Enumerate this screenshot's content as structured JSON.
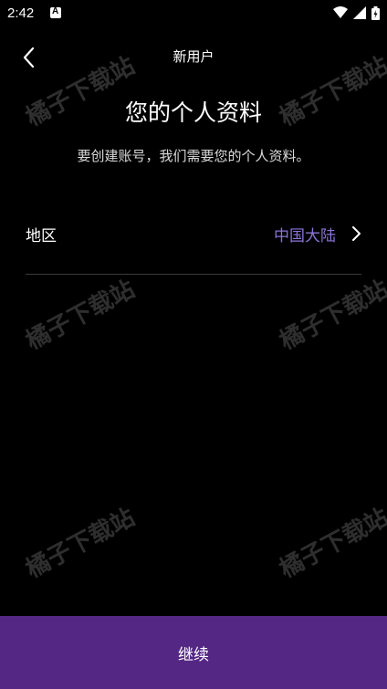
{
  "status_bar": {
    "time": "2:42",
    "icons": [
      "a-notification-icon",
      "wifi-icon",
      "signal-icon",
      "battery-icon"
    ]
  },
  "top_bar": {
    "back_icon": "chevron-left-icon",
    "title": "新用户"
  },
  "main": {
    "heading": "您的个人资料",
    "subheading": "要创建账号，我们需要您的个人资料。",
    "region": {
      "label": "地区",
      "value": "中国大陆",
      "icon": "chevron-right-icon"
    }
  },
  "footer": {
    "continue_label": "继续"
  },
  "watermark": {
    "text": "橘子下载站"
  },
  "colors": {
    "background": "#000000",
    "accent_value": "#8a74d6",
    "button": "#542784",
    "divider": "#3a3a3a"
  }
}
